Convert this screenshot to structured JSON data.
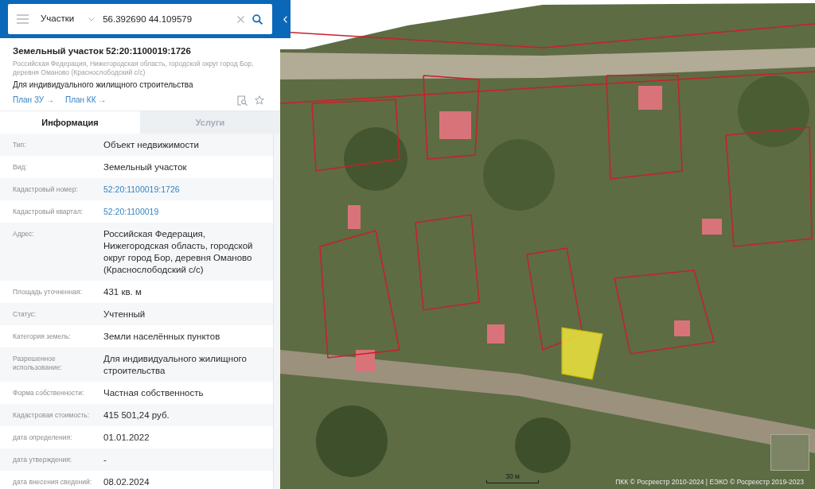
{
  "search_bar": {
    "category": "Участки",
    "query": "56.392690 44.109579"
  },
  "object_card": {
    "title": "Земельный участок 52:20:1100019:1726",
    "address": "Российская Федерация, Нижегородская область, городской округ город Бор, деревня Оманово (Краснослободский с/с)",
    "purpose": "Для индивидуального жилищного строительства",
    "links": [
      {
        "label": "План ЗУ →"
      },
      {
        "label": "План КК →"
      }
    ]
  },
  "tabs": [
    {
      "label": "Информация",
      "selected": true
    },
    {
      "label": "Услуги",
      "selected": false
    }
  ],
  "properties": [
    {
      "label": "Тип:",
      "value": "Объект недвижимости",
      "kind": "text"
    },
    {
      "label": "Вид:",
      "value": "Земельный участок",
      "kind": "text"
    },
    {
      "label": "Кадастровый номер:",
      "value": "52:20:1100019:1726",
      "kind": "link"
    },
    {
      "label": "Кадастровый квартал:",
      "value": "52:20:1100019",
      "kind": "link"
    },
    {
      "label": "Адрес:",
      "value": "Российская Федерация, Нижегородская область, городской округ город Бор, деревня Оманово (Краснослободский с/с)",
      "kind": "text"
    },
    {
      "label": "Площадь уточненная:",
      "value": "431 кв. м",
      "kind": "text"
    },
    {
      "label": "Статус:",
      "value": "Учтенный",
      "kind": "text"
    },
    {
      "label": "Категория земель:",
      "value": "Земли населённых пунктов",
      "kind": "text"
    },
    {
      "label": "Разрешенное использование:",
      "value": "Для индивидуального жилищного строительства",
      "kind": "text"
    },
    {
      "label": "Форма собственности:",
      "value": "Частная собственность",
      "kind": "text"
    },
    {
      "label": "Кадастровая стоимость:",
      "value": "415 501,24 руб.",
      "kind": "text"
    },
    {
      "label": "дата определения:",
      "value": "01.01.2022",
      "kind": "text"
    },
    {
      "label": "дата утверждения:",
      "value": "-",
      "kind": "text"
    },
    {
      "label": "дата внесения сведений:",
      "value": "08.02.2024",
      "kind": "text"
    }
  ],
  "map": {
    "scale_label": "30 м",
    "attribution": "ПКК © Росреестр 2010-2024 | ЕЭКО © Росреестр 2019-2023"
  }
}
